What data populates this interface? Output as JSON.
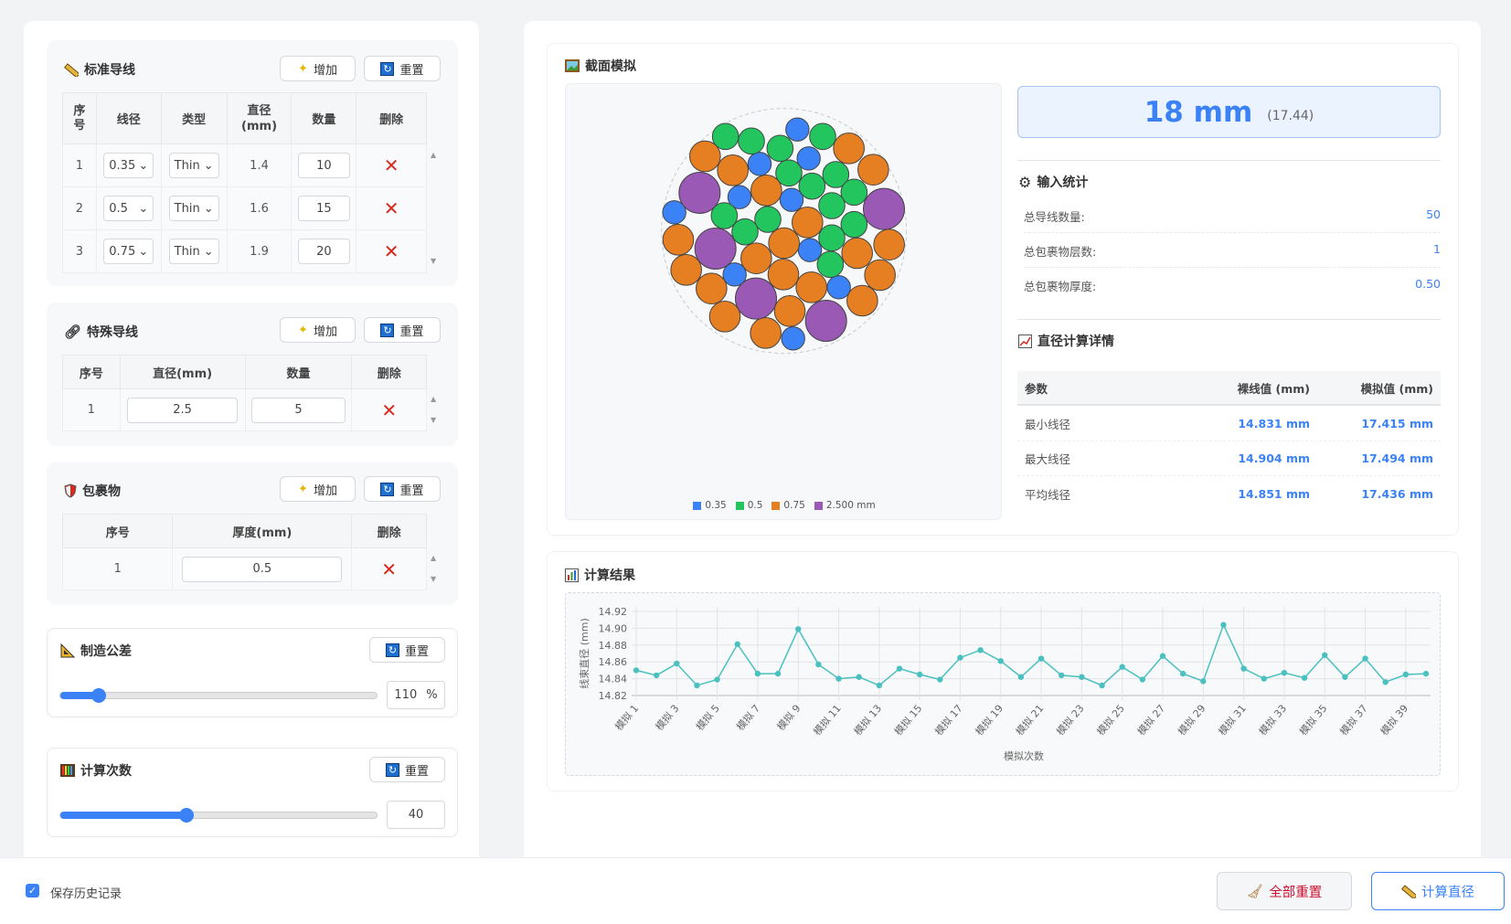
{
  "standard_wires": {
    "title": "标准导线",
    "add_label": "增加",
    "reset_label": "重置",
    "headers": [
      "序\n号",
      "线径",
      "类型",
      "直径\n(mm)",
      "数量",
      "删除"
    ],
    "rows": [
      {
        "index": "1",
        "gauge": "0.35",
        "type": "Thin",
        "diameter": "1.4",
        "quantity": "10"
      },
      {
        "index": "2",
        "gauge": "0.5",
        "type": "Thin",
        "diameter": "1.6",
        "quantity": "15"
      },
      {
        "index": "3",
        "gauge": "0.75",
        "type": "Thin",
        "diameter": "1.9",
        "quantity": "20"
      }
    ]
  },
  "special_wires": {
    "title": "特殊导线",
    "add_label": "增加",
    "reset_label": "重置",
    "headers": [
      "序号",
      "直径(mm)",
      "数量",
      "删除"
    ],
    "rows": [
      {
        "index": "1",
        "diameter": "2.5",
        "quantity": "5"
      }
    ]
  },
  "wrapping": {
    "title": "包裹物",
    "add_label": "增加",
    "reset_label": "重置",
    "headers": [
      "序号",
      "厚度(mm)",
      "删除"
    ],
    "rows": [
      {
        "index": "1",
        "thickness": "0.5"
      }
    ]
  },
  "tolerance": {
    "title": "制造公差",
    "reset_label": "重置",
    "value": "110",
    "unit": "%",
    "slider_fraction": 0.12
  },
  "iterations": {
    "title": "计算次数",
    "reset_label": "重置",
    "value": "40",
    "slider_fraction": 0.4
  },
  "footer": {
    "save_history_label": "保存历史记录",
    "save_history_checked": true,
    "reset_all_label": "全部重置",
    "calculate_label": "计算直径"
  },
  "cross_section": {
    "title": "截面模拟",
    "legend": [
      {
        "label": "0.35",
        "color": "#3b82f6",
        "count": 10
      },
      {
        "label": "0.5",
        "color": "#22c55e",
        "count": 15
      },
      {
        "label": "0.75",
        "color": "#e67e22",
        "count": 20
      },
      {
        "label": "2.500 mm",
        "color": "#9b59b6",
        "count": 5
      }
    ]
  },
  "result": {
    "main_value": "18 mm",
    "raw_value": "(17.44)"
  },
  "input_stats": {
    "title": "输入统计",
    "rows": [
      {
        "label": "总导线数量:",
        "value": "50"
      },
      {
        "label": "总包裹物层数:",
        "value": "1"
      },
      {
        "label": "总包裹物厚度:",
        "value": "0.50"
      }
    ]
  },
  "diameter_details": {
    "title": "直径计算详情",
    "headers": [
      "参数",
      "裸线值 (mm)",
      "模拟值 (mm)"
    ],
    "rows": [
      {
        "param": "最小线径",
        "bare": "14.831 mm",
        "sim": "17.415 mm"
      },
      {
        "param": "最大线径",
        "bare": "14.904 mm",
        "sim": "17.494 mm"
      },
      {
        "param": "平均线径",
        "bare": "14.851 mm",
        "sim": "17.436 mm"
      }
    ]
  },
  "results_section": {
    "title": "计算结果"
  },
  "chart_data": {
    "type": "line",
    "title": "",
    "xlabel": "模拟次数",
    "ylabel": "线束直径 (mm)",
    "ylim": [
      14.82,
      14.92
    ],
    "yticks": [
      "14.92",
      "14.90",
      "14.88",
      "14.86",
      "14.84",
      "14.82"
    ],
    "x_tick_labels": [
      "模拟 1",
      "模拟 3",
      "模拟 5",
      "模拟 7",
      "模拟 9",
      "模拟 11",
      "模拟 13",
      "模拟 15",
      "模拟 17",
      "模拟 19",
      "模拟 21",
      "模拟 23",
      "模拟 25",
      "模拟 27",
      "模拟 29",
      "模拟 31",
      "模拟 33",
      "模拟 35",
      "模拟 37",
      "模拟 39"
    ],
    "color": "#4bc0c0",
    "values": [
      14.85,
      14.844,
      14.858,
      14.832,
      14.839,
      14.881,
      14.846,
      14.846,
      14.899,
      14.857,
      14.84,
      14.842,
      14.832,
      14.852,
      14.845,
      14.839,
      14.865,
      14.874,
      14.861,
      14.842,
      14.864,
      14.844,
      14.842,
      14.832,
      14.854,
      14.839,
      14.867,
      14.846,
      14.837,
      14.904,
      14.852,
      14.84,
      14.847,
      14.841,
      14.868,
      14.842,
      14.864,
      14.836,
      14.845,
      14.846
    ]
  }
}
